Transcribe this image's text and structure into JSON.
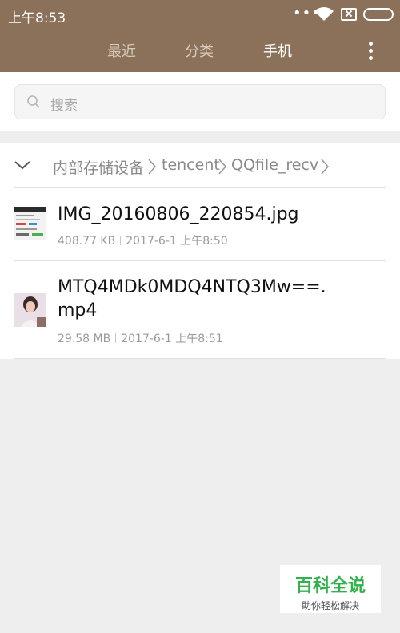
{
  "status_bar": {
    "time": "上午8:53",
    "dots": "•••"
  },
  "tabs": [
    {
      "label": "最近",
      "active": false
    },
    {
      "label": "分类",
      "active": false
    },
    {
      "label": "手机",
      "active": true
    }
  ],
  "search": {
    "placeholder": "搜索"
  },
  "breadcrumb": {
    "items": [
      "内部存储设备",
      "tencent",
      "QQfile_recv"
    ]
  },
  "files": [
    {
      "name": "IMG_20160806_220854.jpg",
      "size": "408.77 KB",
      "date": "2017-6-1 上午8:50",
      "thumb": "image-thumbnail"
    },
    {
      "name_line1": "MTQ4MDk0MDQ4NTQ3Mw==.",
      "name_line2": "mp4",
      "size": "29.58 MB",
      "date": "2017-6-1 上午8:51",
      "thumb": "video-thumbnail"
    }
  ],
  "watermark": {
    "title": "百科全说",
    "subtitle": "助你轻松解决"
  },
  "colors": {
    "header": "#8b7159",
    "watermark_green": "#2fb24a"
  }
}
